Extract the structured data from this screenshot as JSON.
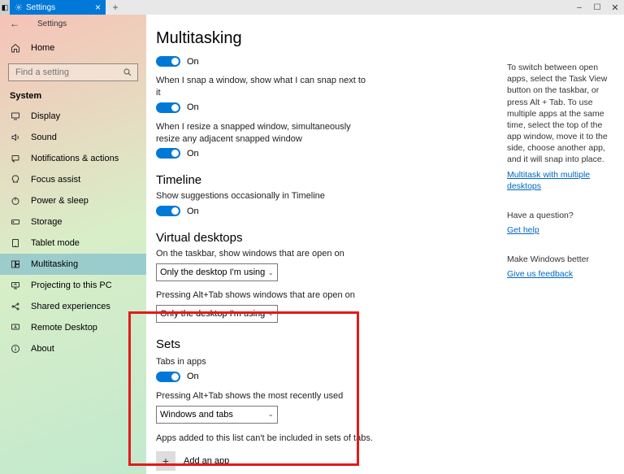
{
  "titlebar": {
    "tab_label": "Settings",
    "close_glyph": "×",
    "newtab_glyph": "+",
    "min_glyph": "–",
    "max_glyph": "☐",
    "winclose_glyph": "✕"
  },
  "sidebar": {
    "back_glyph": "←",
    "title": "Settings",
    "home_label": "Home",
    "search_placeholder": "Find a setting",
    "section": "System",
    "items": [
      {
        "icon": "display",
        "label": "Display"
      },
      {
        "icon": "sound",
        "label": "Sound"
      },
      {
        "icon": "notify",
        "label": "Notifications & actions"
      },
      {
        "icon": "focus",
        "label": "Focus assist"
      },
      {
        "icon": "power",
        "label": "Power & sleep"
      },
      {
        "icon": "storage",
        "label": "Storage"
      },
      {
        "icon": "tablet",
        "label": "Tablet mode"
      },
      {
        "icon": "multi",
        "label": "Multitasking",
        "selected": true
      },
      {
        "icon": "project",
        "label": "Projecting to this PC"
      },
      {
        "icon": "shared",
        "label": "Shared experiences"
      },
      {
        "icon": "remote",
        "label": "Remote Desktop"
      },
      {
        "icon": "about",
        "label": "About"
      }
    ]
  },
  "main": {
    "heading": "Multitasking",
    "snap_on": "On",
    "snap1_text": "When I snap a window, show what I can snap next to it",
    "snap1_on": "On",
    "snap2_text": "When I resize a snapped window, simultaneously resize any adjacent snapped window",
    "snap2_on": "On",
    "timeline_hdr": "Timeline",
    "timeline_text": "Show suggestions occasionally in Timeline",
    "timeline_on": "On",
    "vd_hdr": "Virtual desktops",
    "vd1_text": "On the taskbar, show windows that are open on",
    "vd1_sel": "Only the desktop I'm using",
    "vd2_text": "Pressing Alt+Tab shows windows that are open on",
    "vd2_sel": "Only the desktop I'm using",
    "sets_hdr": "Sets",
    "sets_tabs_label": "Tabs in apps",
    "sets_tabs_on": "On",
    "sets_alttab_text": "Pressing Alt+Tab shows the most recently used",
    "sets_alttab_sel": "Windows and tabs",
    "sets_note": "Apps added to this list can't be included in sets of tabs.",
    "sets_add": "Add an app"
  },
  "help": {
    "para": "To switch between open apps, select the Task View button on the taskbar, or press Alt + Tab. To use multiple apps at the same time, select the top of the app window, move it to the side, choose another app, and it will snap into place.",
    "link1": "Multitask with multiple desktops",
    "q_hdr": "Have a question?",
    "q_link": "Get help",
    "fb_hdr": "Make Windows better",
    "fb_link": "Give us feedback"
  }
}
